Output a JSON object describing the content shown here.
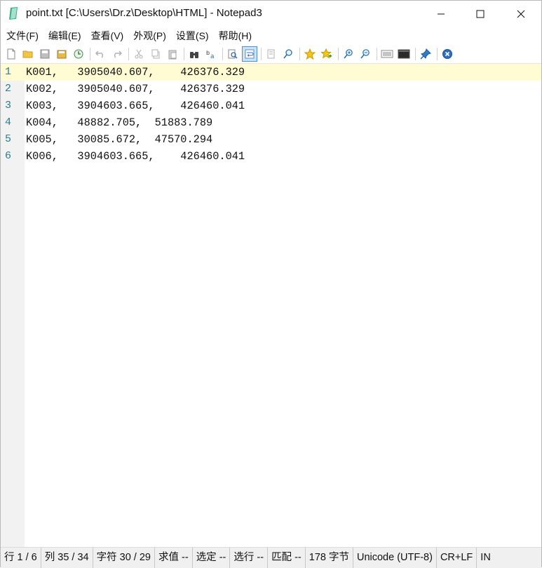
{
  "window": {
    "title": "point.txt [C:\\Users\\Dr.z\\Desktop\\HTML] - Notepad3"
  },
  "menu": [
    "文件(F)",
    "编辑(E)",
    "查看(V)",
    "外观(P)",
    "设置(S)",
    "帮助(H)"
  ],
  "toolbar_icons": [
    "new-file-icon",
    "open-folder-icon",
    "save-icon",
    "save-as-icon",
    "recent-history-icon",
    "undo-icon",
    "redo-icon",
    "cut-icon",
    "copy-icon",
    "paste-icon",
    "find-binoculars-icon",
    "replace-icon",
    "find-in-files-icon",
    "word-wrap-icon",
    "select-all-icon",
    "zoom-find-icon",
    "favorites-star-icon",
    "add-favorite-icon",
    "zoom-in-icon",
    "zoom-out-icon",
    "settings-icon",
    "terminal-icon",
    "pin-icon",
    "close-file-icon"
  ],
  "editor": {
    "line_numbers": [
      "1",
      "2",
      "3",
      "4",
      "5",
      "6"
    ],
    "lines": [
      "K001,   3905040.607,    426376.329",
      "K002,   3905040.607,    426376.329",
      "K003,   3904603.665,    426460.041",
      "K004,   48882.705,  51883.789",
      "K005,   30085.672,  47570.294",
      "K006,   3904603.665,    426460.041"
    ]
  },
  "status": {
    "line": "行 1 / 6",
    "col": "列 35 / 34",
    "char": "字符 30 / 29",
    "value": "求值 --",
    "selected": "选定 --",
    "selected_lines": "选行 --",
    "match": "匹配 --",
    "bytes": "178 字节",
    "encoding": "Unicode (UTF-8)",
    "eol": "CR+LF",
    "mode": "IN"
  },
  "colors": {
    "current_line": "#fffbd2",
    "gutter": "#f2f2f2",
    "line_number": "#2b7d8c"
  }
}
